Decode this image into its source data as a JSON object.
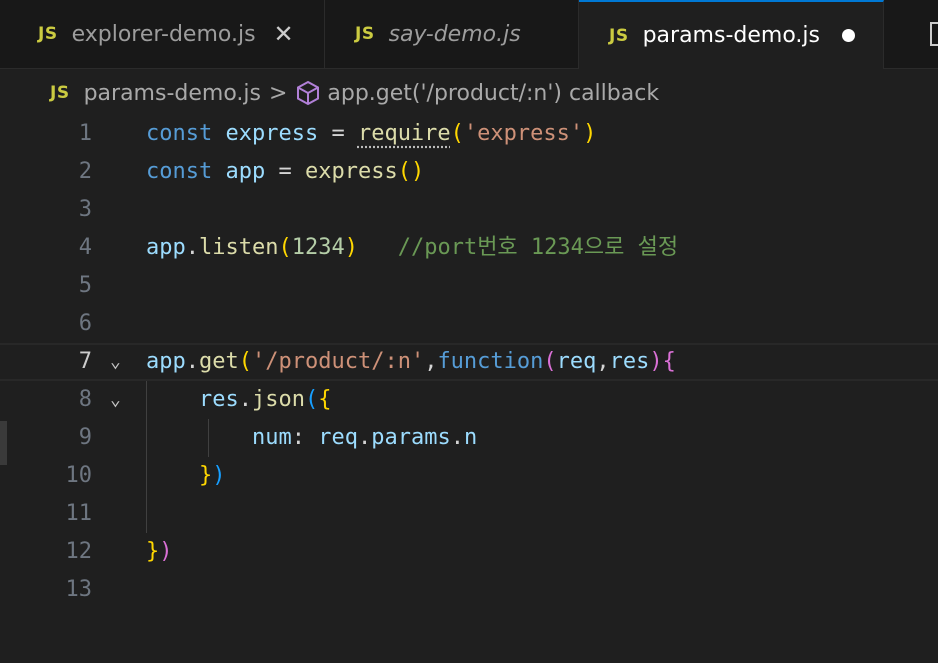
{
  "tabs": [
    {
      "badge": "JS",
      "label": "explorer-demo.js",
      "close": "✕"
    },
    {
      "badge": "JS",
      "label": "say-demo.js"
    },
    {
      "badge": "JS",
      "label": "params-demo.js"
    }
  ],
  "breadcrumb": {
    "badge": "JS",
    "file": "params-demo.js",
    "separator": ">",
    "symbol": "app.get('/product/:n') callback"
  },
  "editor": {
    "current_line": 7,
    "line_numbers": [
      "1",
      "2",
      "3",
      "4",
      "5",
      "6",
      "7",
      "8",
      "9",
      "10",
      "11",
      "12",
      "13"
    ],
    "lines": [
      [
        {
          "t": "kw",
          "v": "const"
        },
        {
          "t": "punc",
          "v": " "
        },
        {
          "t": "var",
          "v": "express"
        },
        {
          "t": "punc",
          "v": " = "
        },
        {
          "t": "fn",
          "v": "require",
          "dots": true
        },
        {
          "t": "p1",
          "v": "("
        },
        {
          "t": "str",
          "v": "'express'"
        },
        {
          "t": "p1",
          "v": ")"
        }
      ],
      [
        {
          "t": "kw",
          "v": "const"
        },
        {
          "t": "punc",
          "v": " "
        },
        {
          "t": "var",
          "v": "app"
        },
        {
          "t": "punc",
          "v": " = "
        },
        {
          "t": "fn",
          "v": "express"
        },
        {
          "t": "p1",
          "v": "()"
        }
      ],
      [],
      [
        {
          "t": "var",
          "v": "app"
        },
        {
          "t": "punc",
          "v": "."
        },
        {
          "t": "fn",
          "v": "listen"
        },
        {
          "t": "p1",
          "v": "("
        },
        {
          "t": "num",
          "v": "1234"
        },
        {
          "t": "p1",
          "v": ")"
        },
        {
          "t": "punc",
          "v": "   "
        },
        {
          "t": "cmt",
          "v": "//port번호 1234으로 설정"
        }
      ],
      [],
      [],
      [
        {
          "t": "var",
          "v": "app"
        },
        {
          "t": "punc",
          "v": "."
        },
        {
          "t": "fn",
          "v": "get"
        },
        {
          "t": "p1",
          "v": "("
        },
        {
          "t": "str",
          "v": "'/product/:n'"
        },
        {
          "t": "punc",
          "v": ","
        },
        {
          "t": "kw",
          "v": "function"
        },
        {
          "t": "p2",
          "v": "("
        },
        {
          "t": "var",
          "v": "req"
        },
        {
          "t": "punc",
          "v": ","
        },
        {
          "t": "var",
          "v": "res"
        },
        {
          "t": "p2",
          "v": ")"
        },
        {
          "t": "p2",
          "v": "{"
        }
      ],
      [
        {
          "t": "punc",
          "v": "    "
        },
        {
          "t": "var",
          "v": "res"
        },
        {
          "t": "punc",
          "v": "."
        },
        {
          "t": "fn",
          "v": "json"
        },
        {
          "t": "p3",
          "v": "("
        },
        {
          "t": "p1",
          "v": "{"
        }
      ],
      [
        {
          "t": "punc",
          "v": "        "
        },
        {
          "t": "prop",
          "v": "num"
        },
        {
          "t": "punc",
          "v": ": "
        },
        {
          "t": "var",
          "v": "req"
        },
        {
          "t": "punc",
          "v": "."
        },
        {
          "t": "var",
          "v": "params"
        },
        {
          "t": "punc",
          "v": "."
        },
        {
          "t": "var",
          "v": "n"
        }
      ],
      [
        {
          "t": "punc",
          "v": "    "
        },
        {
          "t": "p1",
          "v": "}"
        },
        {
          "t": "p3",
          "v": ")"
        }
      ],
      [],
      [
        {
          "t": "p1",
          "v": "}"
        },
        {
          "t": "p2",
          "v": ")"
        }
      ],
      []
    ],
    "fold_lines": [
      7,
      8
    ]
  },
  "colors": {
    "accent": "#0078d4",
    "js_badge": "#cbcb41",
    "background": "#1f1f1f"
  }
}
